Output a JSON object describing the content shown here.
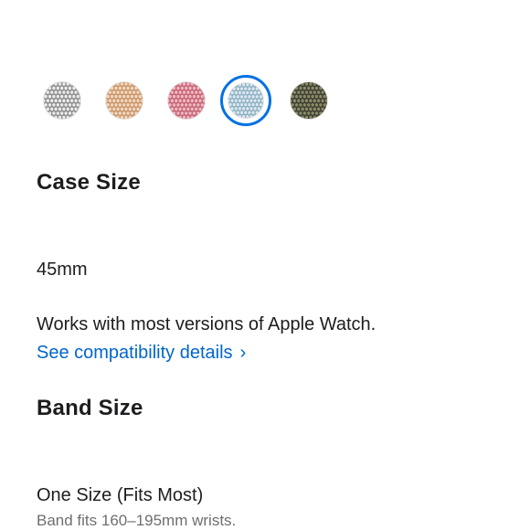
{
  "color_swatches": [
    {
      "name": "silver",
      "base": "#8e8e8e",
      "dot": "#ececec",
      "selected": false
    },
    {
      "name": "gold",
      "base": "#c8956a",
      "dot": "#f4d8bf",
      "selected": false
    },
    {
      "name": "pink",
      "base": "#c46474",
      "dot": "#f0b8c2",
      "selected": false
    },
    {
      "name": "blue",
      "base": "#8fb0c2",
      "dot": "#dbe9f1",
      "selected": true
    },
    {
      "name": "olive",
      "base": "#3f3f30",
      "dot": "#8a8c6a",
      "selected": false
    }
  ],
  "case_size": {
    "title": "Case Size",
    "value": "45mm",
    "compatibility_text": "Works with most versions of Apple Watch.",
    "compatibility_link": "See compatibility details",
    "chevron": "›"
  },
  "band_size": {
    "title": "Band Size",
    "value": "One Size (Fits Most)",
    "fit_text": "Band fits 160–195mm wrists."
  },
  "accent_color": "#0071e3",
  "link_color": "#0066cc"
}
